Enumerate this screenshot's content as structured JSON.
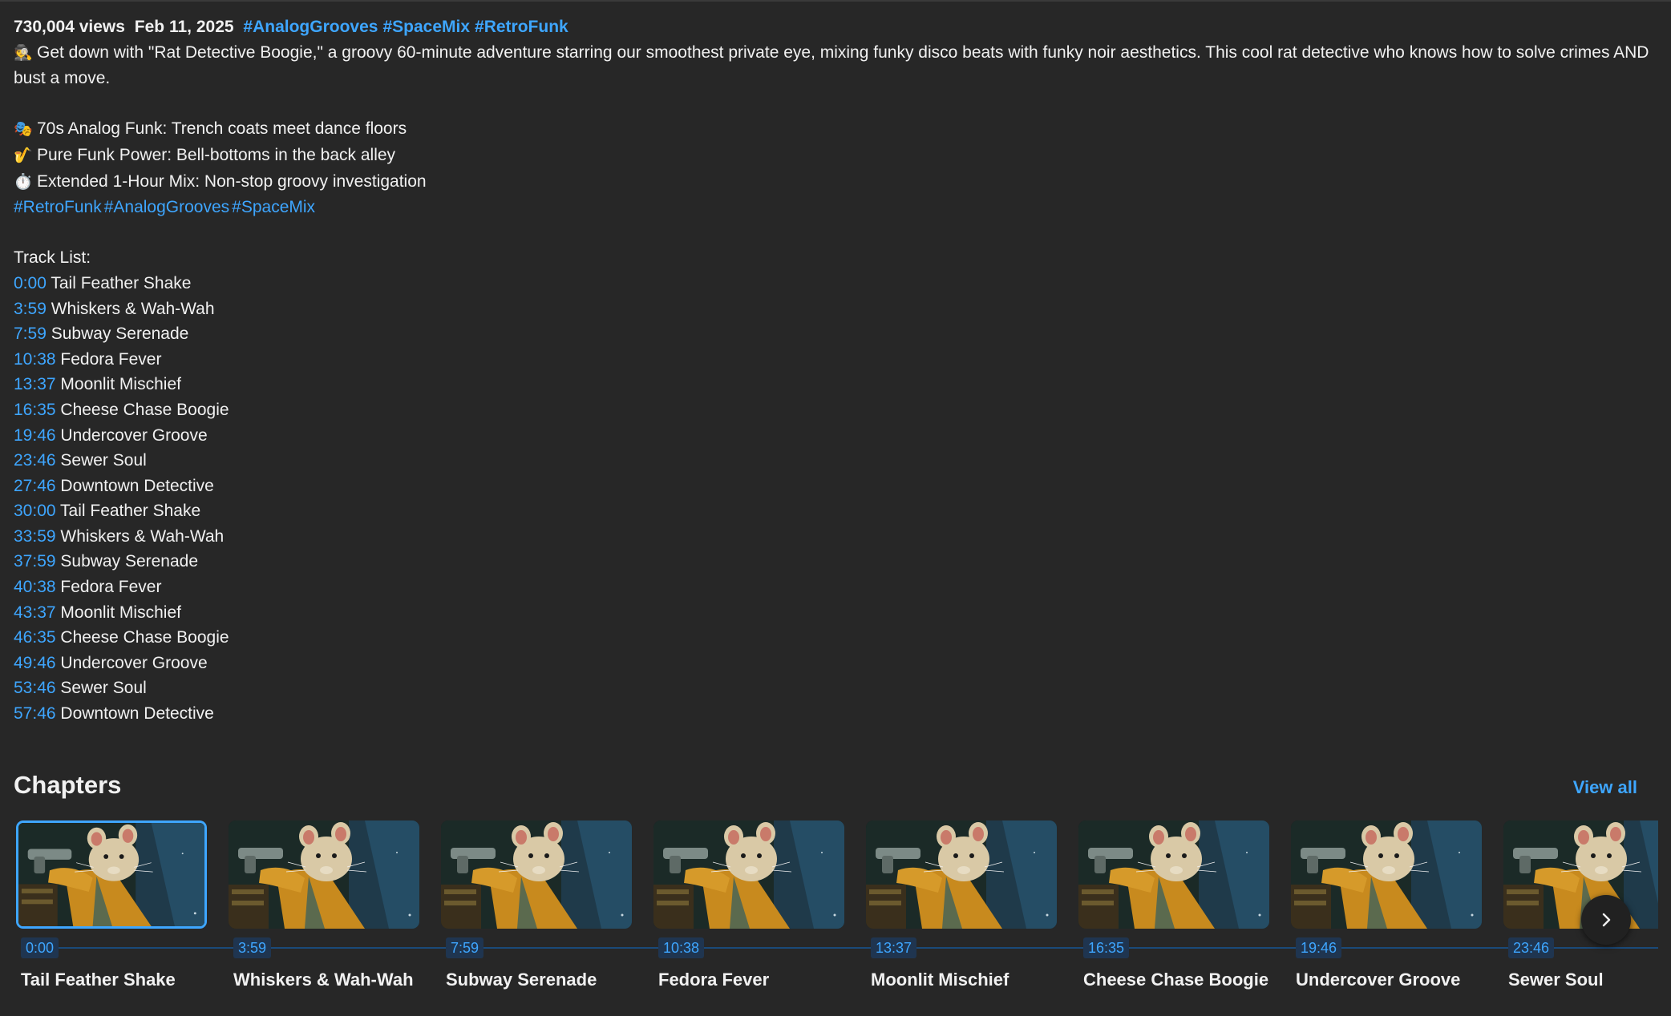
{
  "description": {
    "views": "730,004 views",
    "date": "Feb 11, 2025",
    "top_tags": [
      "#AnalogGrooves",
      "#SpaceMix",
      "#RetroFunk"
    ],
    "intro_emoji": "🕵️",
    "intro_text": "Get down with \"Rat Detective Boogie,\" a groovy 60-minute adventure starring our smoothest private eye, mixing funky disco beats with funky noir aesthetics. This cool rat detective who knows how to solve crimes AND bust a move.",
    "bullets": [
      {
        "emoji": "🎭",
        "text": "70s Analog Funk: Trench coats meet dance floors"
      },
      {
        "emoji": "🎷",
        "text": "Pure Funk Power: Bell-bottoms in the back alley"
      },
      {
        "emoji": "⏱️",
        "text": "Extended 1-Hour Mix: Non-stop groovy investigation"
      }
    ],
    "bottom_tags": [
      "#RetroFunk",
      "#AnalogGrooves",
      "#SpaceMix"
    ],
    "tracklist_heading": "Track List:",
    "tracks": [
      {
        "time": "0:00",
        "title": "Tail Feather Shake"
      },
      {
        "time": "3:59",
        "title": "Whiskers & Wah-Wah"
      },
      {
        "time": "7:59",
        "title": "Subway Serenade"
      },
      {
        "time": "10:38",
        "title": "Fedora Fever"
      },
      {
        "time": "13:37",
        "title": "Moonlit Mischief"
      },
      {
        "time": "16:35",
        "title": "Cheese Chase Boogie"
      },
      {
        "time": "19:46",
        "title": "Undercover Groove"
      },
      {
        "time": "23:46",
        "title": "Sewer Soul"
      },
      {
        "time": "27:46",
        "title": "Downtown Detective"
      },
      {
        "time": "30:00",
        "title": "Tail Feather Shake"
      },
      {
        "time": "33:59",
        "title": "Whiskers & Wah-Wah"
      },
      {
        "time": "37:59",
        "title": "Subway Serenade"
      },
      {
        "time": "40:38",
        "title": "Fedora Fever"
      },
      {
        "time": "43:37",
        "title": "Moonlit Mischief"
      },
      {
        "time": "46:35",
        "title": "Cheese Chase Boogie"
      },
      {
        "time": "49:46",
        "title": "Undercover Groove"
      },
      {
        "time": "53:46",
        "title": "Sewer Soul"
      },
      {
        "time": "57:46",
        "title": "Downtown Detective"
      }
    ]
  },
  "chapters": {
    "heading": "Chapters",
    "view_all_label": "View all",
    "active_index": 0,
    "next_icon": "chevron-right-icon",
    "items": [
      {
        "time": "0:00",
        "title": "Tail Feather Shake"
      },
      {
        "time": "3:59",
        "title": "Whiskers & Wah-Wah"
      },
      {
        "time": "7:59",
        "title": "Subway Serenade"
      },
      {
        "time": "10:38",
        "title": "Fedora Fever"
      },
      {
        "time": "13:37",
        "title": "Moonlit Mischief"
      },
      {
        "time": "16:35",
        "title": "Cheese Chase Boogie"
      },
      {
        "time": "19:46",
        "title": "Undercover Groove"
      },
      {
        "time": "23:46",
        "title": "Sewer Soul"
      }
    ]
  },
  "colors": {
    "background": "#272727",
    "link": "#3ea6ff",
    "text": "#f1f1f1"
  }
}
